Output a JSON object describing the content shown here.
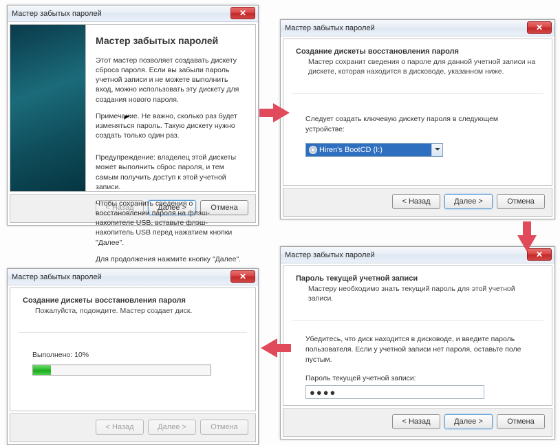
{
  "common": {
    "window_title": "Мастер забытых паролей",
    "back": "< Назад",
    "next": "Далее >",
    "cancel": "Отмена",
    "close_x": "✕"
  },
  "w1": {
    "heading": "Мастер забытых паролей",
    "p1": "Этот мастер позволяет создавать дискету сброса пароля. Если вы забыли пароль учетной записи и не можете выполнить вход, можно использовать эту дискету для создания нового пароля.",
    "p2": "Примечание. Не важно, сколько раз будет изменяться пароль. Такую дискету нужно создать только один раз.",
    "p3": "Предупреждение: владелец этой дискеты может выполнить сброс пароля, и тем самым получить доступ к этой учетной записи.",
    "p4": "Чтобы сохранить сведения о восстановлении пароля на флэш-накопителе USB, вставьте флэш-накопитель USB перед нажатием кнопки \"Далее\".",
    "p5": "Для продолжения нажмите кнопку \"Далее\"."
  },
  "w2": {
    "heading": "Создание дискеты восстановления пароля",
    "sub": "Мастер сохранит сведения о пароле для данной учетной записи на дискете, которая находится в дисководе, указанном ниже.",
    "body": "Следует создать ключевую дискету пароля в следующем устройстве:",
    "combo_value": "Hiren's BootCD (I:)"
  },
  "w3": {
    "heading": "Пароль текущей учетной записи",
    "sub": "Мастеру необходимо знать текущий пароль для этой учетной записи.",
    "body": "Убедитесь, что диск находится в дисководе, и введите пароль пользователя. Если у учетной записи нет пароля, оставьте поле пустым.",
    "pw_label": "Пароль текущей учетной записи:",
    "pw_mask": "●●●●"
  },
  "w4": {
    "heading": "Создание дискеты восстановления пароля",
    "sub": "Пожалуйста, подождите. Мастер создает диск.",
    "progress_label": "Выполнено: 10%",
    "progress_percent": 10
  }
}
